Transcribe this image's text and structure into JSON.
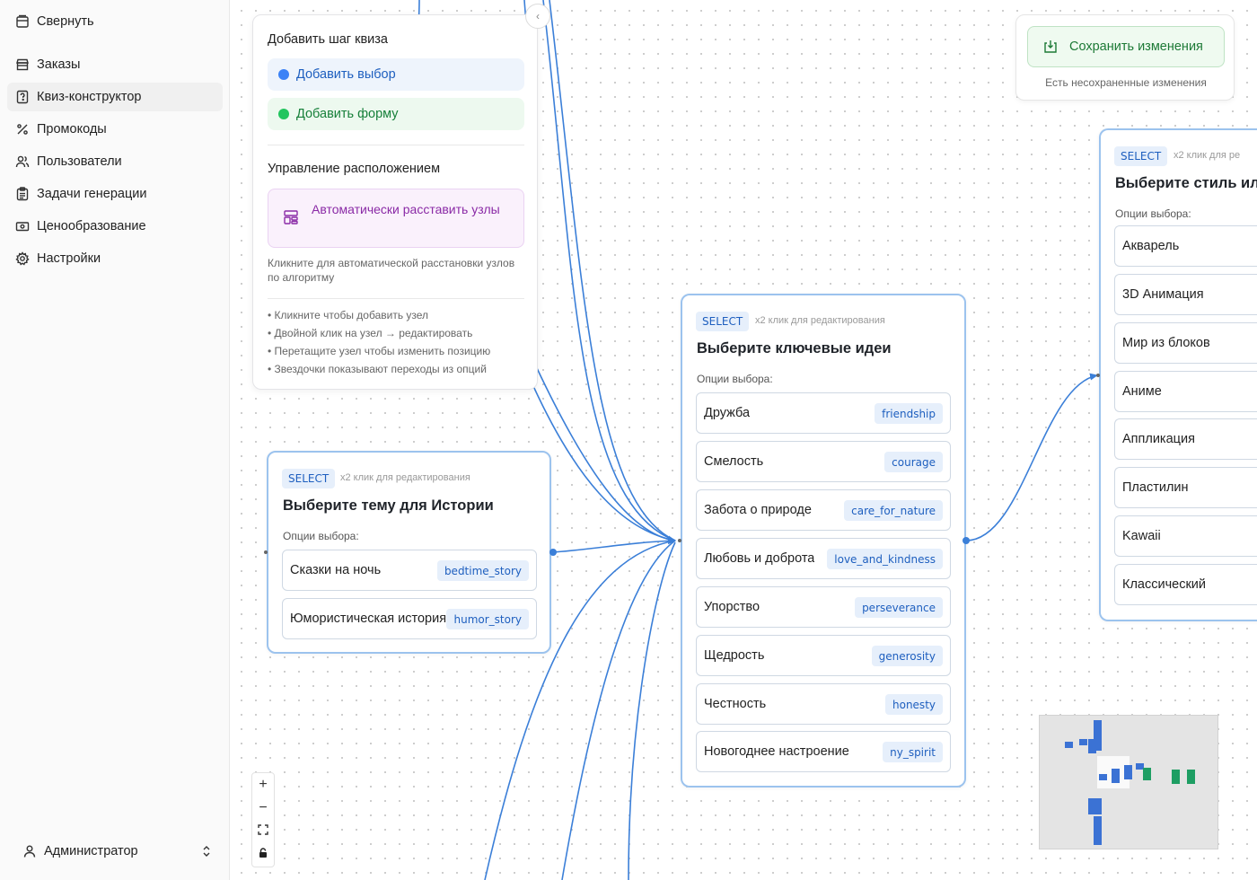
{
  "sidebar": {
    "collapse_label": "Свернуть",
    "items": [
      {
        "label": "Заказы",
        "icon": "store-icon"
      },
      {
        "label": "Квиз-конструктор",
        "icon": "quiz-icon",
        "active": true
      },
      {
        "label": "Промокоды",
        "icon": "percent-icon"
      },
      {
        "label": "Пользователи",
        "icon": "users-icon"
      },
      {
        "label": "Задачи генерации",
        "icon": "clipboard-icon"
      },
      {
        "label": "Ценообразование",
        "icon": "banknote-icon"
      },
      {
        "label": "Настройки",
        "icon": "gear-icon"
      }
    ],
    "user_label": "Администратор"
  },
  "tools": {
    "add_title": "Добавить шаг квиза",
    "add_choice": "Добавить выбор",
    "add_form": "Добавить форму",
    "layout_title": "Управление расположением",
    "auto_layout": "Автоматически расставить узлы",
    "auto_hint": "Кликните для автоматической расстановки узлов по алгоритму",
    "tips": [
      "• Кликните чтобы добавить узел",
      "• Двойной клик на узел → редактировать",
      "• Перетащите узел чтобы изменить позицию",
      "• Звездочки показывают переходы из опций"
    ]
  },
  "save": {
    "button": "Сохранить изменения",
    "note": "Есть несохраненные изменения"
  },
  "nodes": {
    "story": {
      "badge": "SELECT",
      "hint": "x2 клик для редактирования",
      "title": "Выберите тему для Истории",
      "options_label": "Опции выбора:",
      "options": [
        {
          "label": "Сказки на ночь",
          "key": "bedtime_story"
        },
        {
          "label": "Юмористическая история",
          "key": "humor_story"
        }
      ]
    },
    "ideas": {
      "badge": "SELECT",
      "hint": "x2 клик для редактирования",
      "title": "Выберите ключевые идеи",
      "options_label": "Опции выбора:",
      "options": [
        {
          "label": "Дружба",
          "key": "friendship"
        },
        {
          "label": "Смелость",
          "key": "courage"
        },
        {
          "label": "Забота о природе",
          "key": "care_for_nature"
        },
        {
          "label": "Любовь и доброта",
          "key": "love_and_kindness"
        },
        {
          "label": "Упорство",
          "key": "perseverance"
        },
        {
          "label": "Щедрость",
          "key": "generosity"
        },
        {
          "label": "Честность",
          "key": "honesty"
        },
        {
          "label": "Новогоднее настроение",
          "key": "ny_spirit"
        }
      ]
    },
    "style": {
      "badge": "SELECT",
      "hint": "x2 клик для ре",
      "title": "Выберите стиль ил",
      "options_label": "Опции выбора:",
      "options": [
        {
          "label": "Акварель"
        },
        {
          "label": "3D Анимация"
        },
        {
          "label": "Мир из блоков"
        },
        {
          "label": "Аниме"
        },
        {
          "label": "Аппликация"
        },
        {
          "label": "Пластилин"
        },
        {
          "label": "Kawaii"
        },
        {
          "label": "Классический"
        }
      ]
    }
  },
  "zoom_controls": [
    "+",
    "−",
    "fit-view-icon",
    "lock-icon"
  ],
  "colors": {
    "edge": "#3b7fd8",
    "node_border": "#9cc3ee",
    "badge_bg": "#e6effb",
    "badge_text": "#1e5fbf",
    "save_green": "#1d7a36",
    "auto_purple": "#8a2aa6"
  }
}
